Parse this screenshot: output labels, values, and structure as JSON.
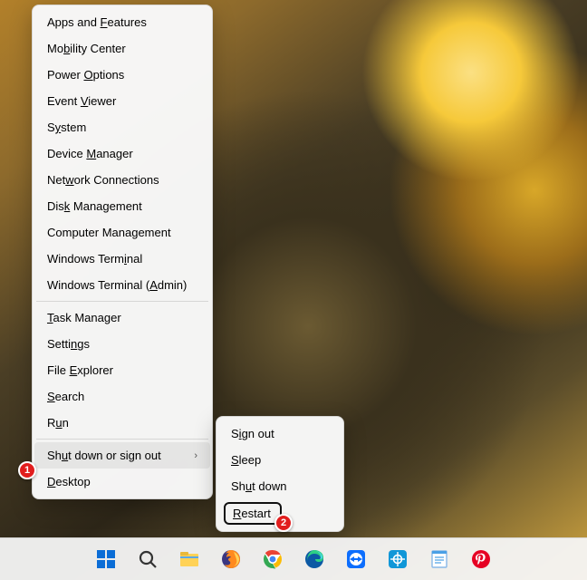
{
  "menu": {
    "items": [
      {
        "pre": "Apps and ",
        "mn": "F",
        "post": "eatures"
      },
      {
        "pre": "Mo",
        "mn": "b",
        "post": "ility Center"
      },
      {
        "pre": "Power ",
        "mn": "O",
        "post": "ptions"
      },
      {
        "pre": "Event ",
        "mn": "V",
        "post": "iewer"
      },
      {
        "pre": "S",
        "mn": "y",
        "post": "stem"
      },
      {
        "pre": "Device ",
        "mn": "M",
        "post": "anager"
      },
      {
        "pre": "Net",
        "mn": "w",
        "post": "ork Connections"
      },
      {
        "pre": "Dis",
        "mn": "k",
        "post": " Management"
      },
      {
        "pre": "Computer Mana",
        "mn": "g",
        "post": "ement"
      },
      {
        "pre": "Windows Term",
        "mn": "i",
        "post": "nal"
      },
      {
        "pre": "Windows Terminal (",
        "mn": "A",
        "post": "dmin)"
      },
      {
        "sep": true
      },
      {
        "pre": "",
        "mn": "T",
        "post": "ask Manager"
      },
      {
        "pre": "Setti",
        "mn": "n",
        "post": "gs"
      },
      {
        "pre": "File ",
        "mn": "E",
        "post": "xplorer"
      },
      {
        "pre": "",
        "mn": "S",
        "post": "earch"
      },
      {
        "pre": "R",
        "mn": "u",
        "post": "n"
      },
      {
        "sep": true
      },
      {
        "pre": "Sh",
        "mn": "u",
        "post": "t down or sign out",
        "chevron": true,
        "hovered": true
      },
      {
        "pre": "",
        "mn": "D",
        "post": "esktop"
      }
    ]
  },
  "submenu": {
    "items": [
      {
        "pre": "S",
        "mn": "i",
        "post": "gn out"
      },
      {
        "pre": "",
        "mn": "S",
        "post": "leep"
      },
      {
        "pre": "Sh",
        "mn": "u",
        "post": "t down"
      },
      {
        "pre": "",
        "mn": "R",
        "post": "estart",
        "highlight": true
      }
    ]
  },
  "badges": {
    "one": "1",
    "two": "2"
  },
  "taskbar": {
    "icons": [
      "start",
      "search",
      "explorer",
      "firefox",
      "chrome",
      "edge",
      "teamviewer",
      "bitwarden",
      "notes",
      "pinterest"
    ]
  }
}
